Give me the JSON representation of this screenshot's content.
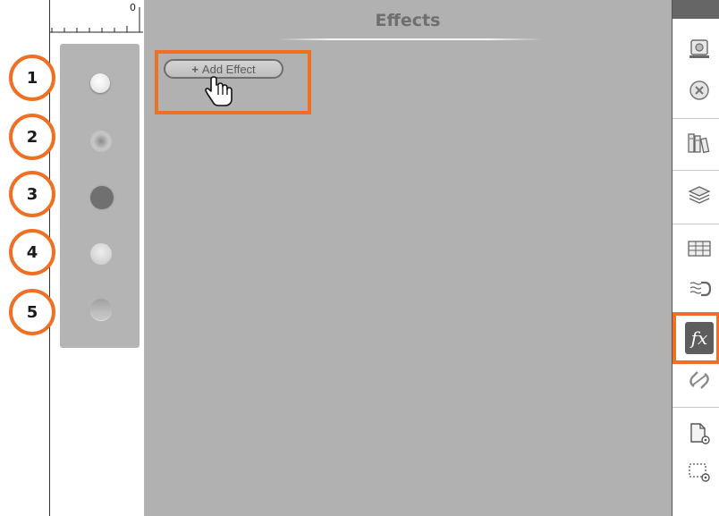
{
  "ruler": {
    "zero_label": "0"
  },
  "steps": [
    "1",
    "2",
    "3",
    "4",
    "5"
  ],
  "panel": {
    "title": "Effects"
  },
  "add_effect": {
    "plus": "+",
    "label": "Add Effect"
  },
  "toolbar": {
    "fx_label": "fx"
  },
  "colors": {
    "highlight": "#ef6f25",
    "panel_bg": "#b1b1b1",
    "swatch_panel_bg": "#b4b4b4",
    "fx_bg": "#5d5d5d"
  }
}
